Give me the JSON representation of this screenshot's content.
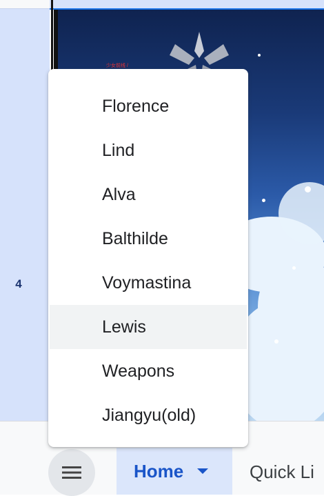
{
  "row_header": {
    "number": "4"
  },
  "image": {
    "caption": "少女前线 /"
  },
  "dropdown": {
    "items": [
      {
        "label": "Florence"
      },
      {
        "label": "Lind"
      },
      {
        "label": "Alva"
      },
      {
        "label": "Balthilde"
      },
      {
        "label": "Voymastina"
      },
      {
        "label": "Lewis",
        "highlighted": true
      },
      {
        "label": "Weapons"
      },
      {
        "label": "Jiangyu(old)"
      }
    ]
  },
  "bottom_bar": {
    "menu_icon": "hamburger-menu-icon",
    "home_tab": {
      "label": "Home",
      "icon": "caret-down-icon"
    },
    "quick_links_tab": {
      "label": "Quick Li"
    }
  },
  "colors": {
    "accent": "#1a55c8",
    "selection": "#d6e2fb",
    "highlight": "#f1f3f4"
  }
}
